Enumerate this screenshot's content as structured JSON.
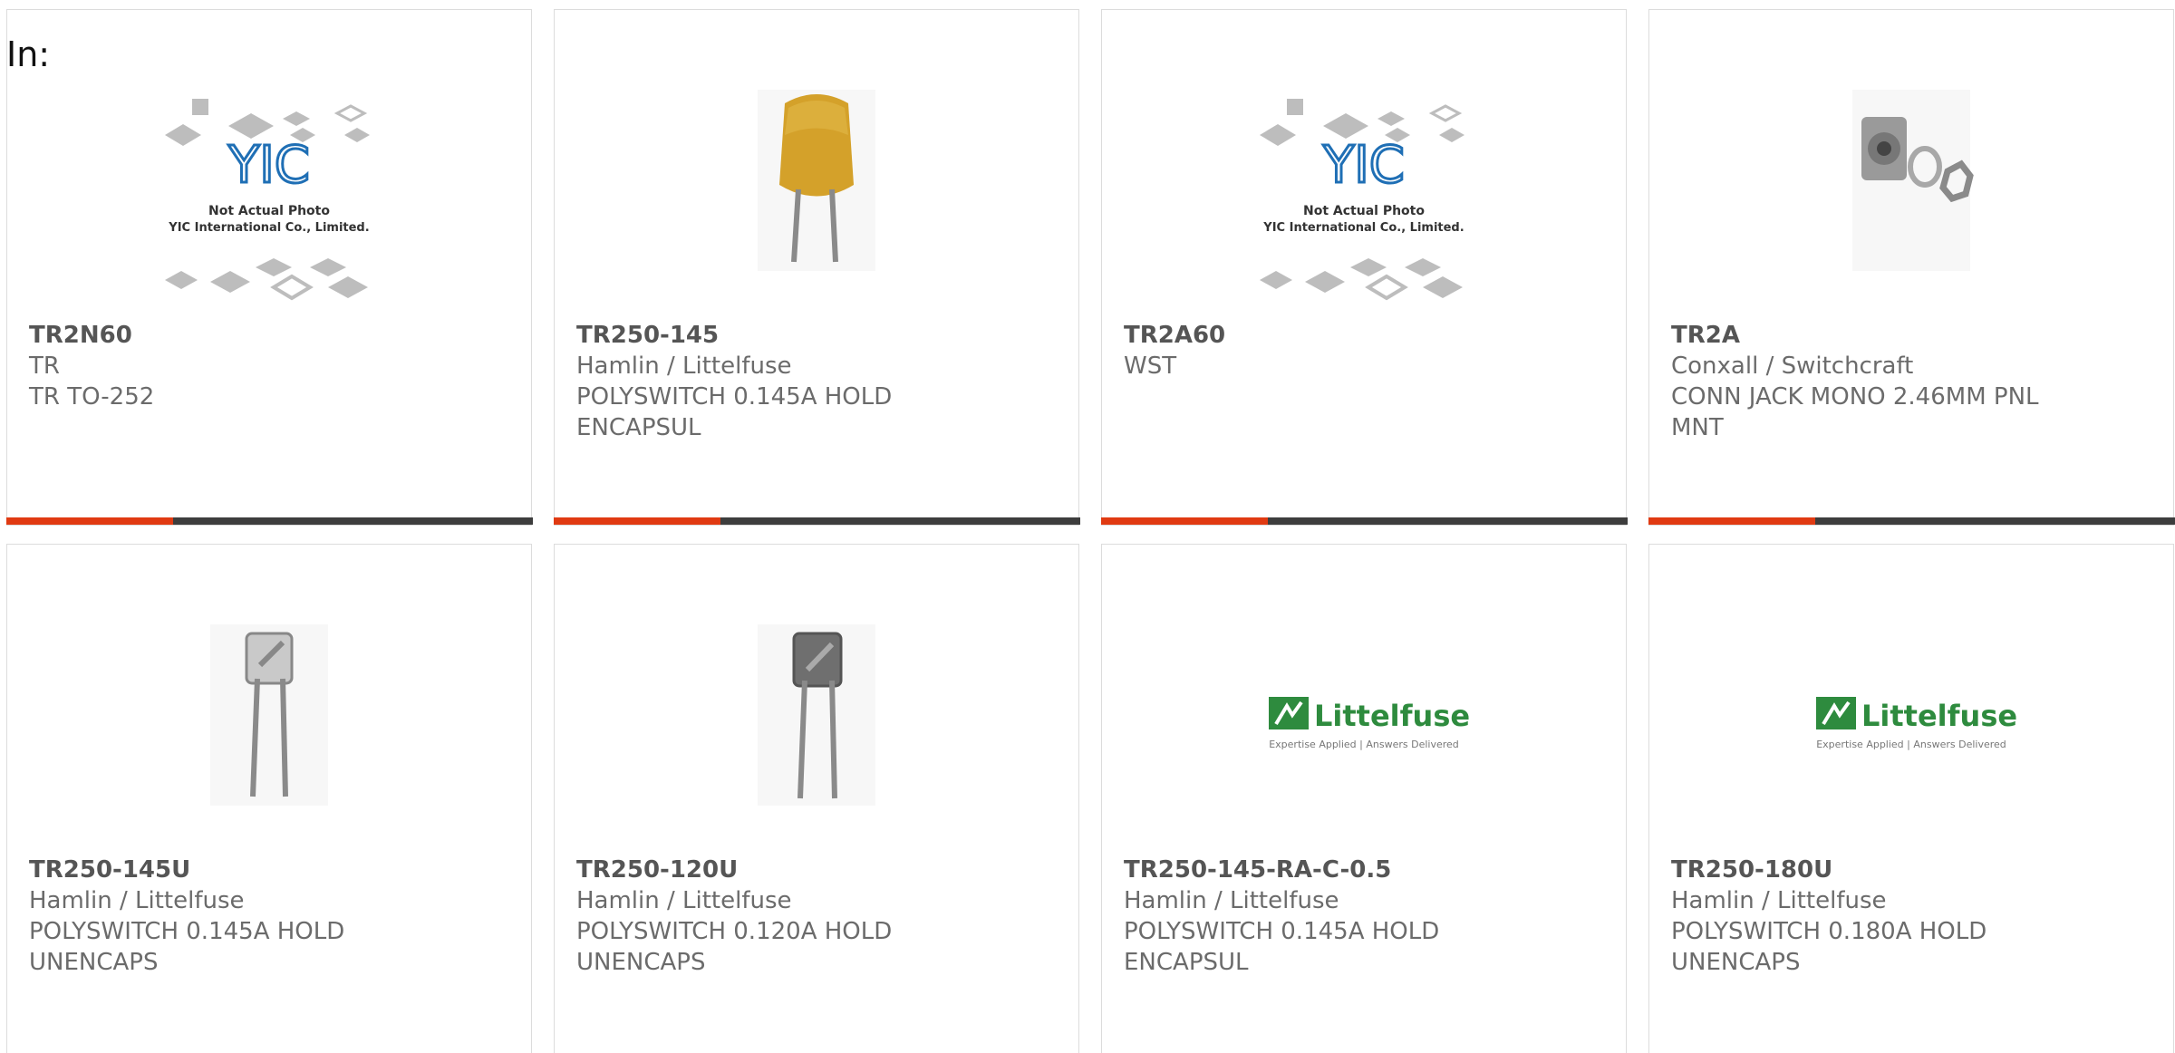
{
  "heading": "In:",
  "products": [
    {
      "part_number": "TR2N60",
      "manufacturer": "TR",
      "description": "TR TO-252",
      "image": "yic-not-actual-photo",
      "image_caption_1": "Not Actual Photo",
      "image_caption_2": "YIC International Co., Limited.",
      "image_logo": "YIC"
    },
    {
      "part_number": "TR250-145",
      "manufacturer": "Hamlin / Littelfuse",
      "description": "POLYSWITCH 0.145A HOLD ENCAPSUL",
      "image": "yellow-radial-ptc-fuse"
    },
    {
      "part_number": "TR2A60",
      "manufacturer": "WST",
      "description": "",
      "image": "yic-not-actual-photo",
      "image_caption_1": "Not Actual Photo",
      "image_caption_2": "YIC International Co., Limited.",
      "image_logo": "YIC"
    },
    {
      "part_number": "TR2A",
      "manufacturer": "Conxall / Switchcraft",
      "description": "CONN JACK MONO 2.46MM PNL MNT",
      "image": "panel-mount-jack-with-washer-nut"
    },
    {
      "part_number": "TR250-145U",
      "manufacturer": "Hamlin / Littelfuse",
      "description": "POLYSWITCH 0.145A HOLD UNENCAPS",
      "image": "unencapsulated-ptc-disc-light"
    },
    {
      "part_number": "TR250-120U",
      "manufacturer": "Hamlin / Littelfuse",
      "description": "POLYSWITCH 0.120A HOLD UNENCAPS",
      "image": "unencapsulated-ptc-disc-dark"
    },
    {
      "part_number": "TR250-145-RA-C-0.5",
      "manufacturer": "Hamlin / Littelfuse",
      "description": "POLYSWITCH 0.145A HOLD ENCAPSUL",
      "image": "littelfuse-logo",
      "logo_text": "Littelfuse",
      "logo_tagline": "Expertise Applied | Answers Delivered"
    },
    {
      "part_number": "TR250-180U",
      "manufacturer": "Hamlin / Littelfuse",
      "description": "POLYSWITCH 0.180A HOLD UNENCAPS",
      "image": "littelfuse-logo",
      "logo_text": "Littelfuse",
      "logo_tagline": "Expertise Applied | Answers Delivered"
    }
  ],
  "colors": {
    "accent_bar": "#e03a12",
    "base_bar": "#3d3d3d",
    "text": "#6b6b6b",
    "littelfuse_green": "#2e8b3e",
    "yic_blue": "#1f6fb5"
  }
}
